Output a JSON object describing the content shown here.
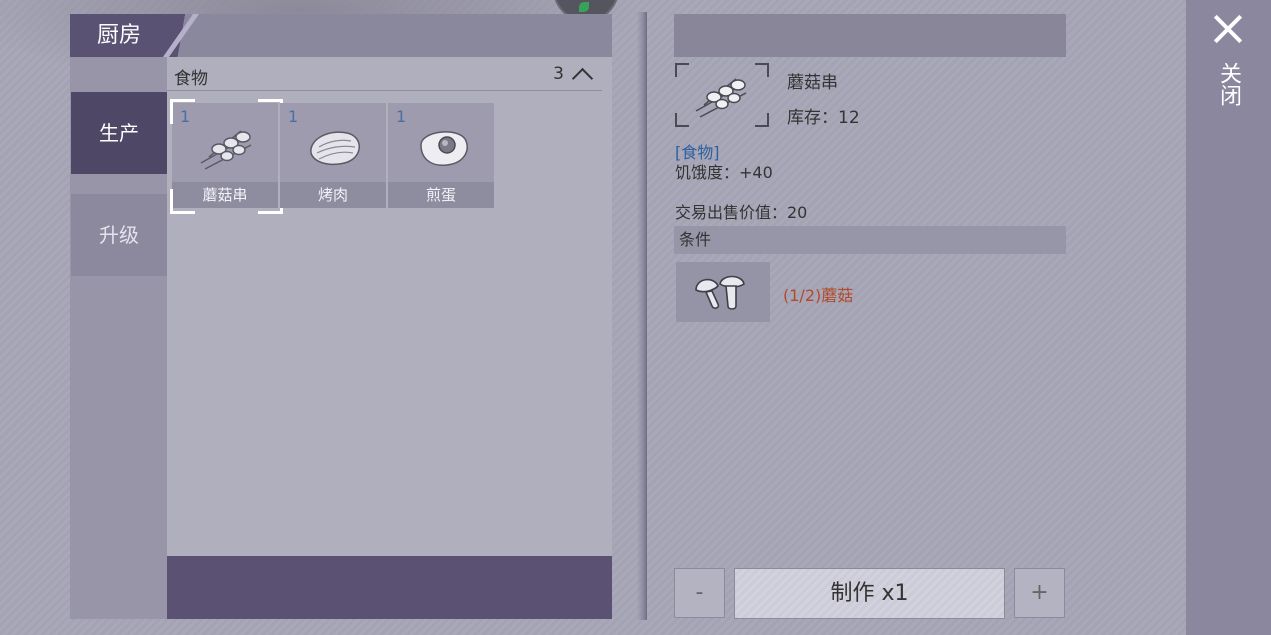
{
  "panel": {
    "title": "厨房",
    "tabs": [
      {
        "label": "生产",
        "active": true
      },
      {
        "label": "升级",
        "active": false
      }
    ],
    "category": {
      "label": "食物",
      "count": "3"
    },
    "items": [
      {
        "count": "1",
        "name": "蘑菇串",
        "icon": "mushroom-skewer-icon",
        "selected": true
      },
      {
        "count": "1",
        "name": "烤肉",
        "icon": "roast-meat-icon",
        "selected": false
      },
      {
        "count": "1",
        "name": "煎蛋",
        "icon": "fried-egg-icon",
        "selected": false
      }
    ]
  },
  "detail": {
    "name": "蘑菇串",
    "stock": "库存：12",
    "category": "[食物]",
    "hunger": "饥饿度：+40",
    "sell_value": "交易出售价值：20",
    "conditions_header": "条件",
    "condition": {
      "text": "(1/2)蘑菇",
      "icon": "mushroom-icon"
    }
  },
  "controls": {
    "minus": "-",
    "make": "制作 x1",
    "plus": "+"
  },
  "close": {
    "label": "关闭"
  },
  "colors": {
    "accent_dark": "#4e4766",
    "condition_text": "#b34a2a",
    "category_text": "#2c5f9e",
    "item_count": "#4c6fa0"
  }
}
